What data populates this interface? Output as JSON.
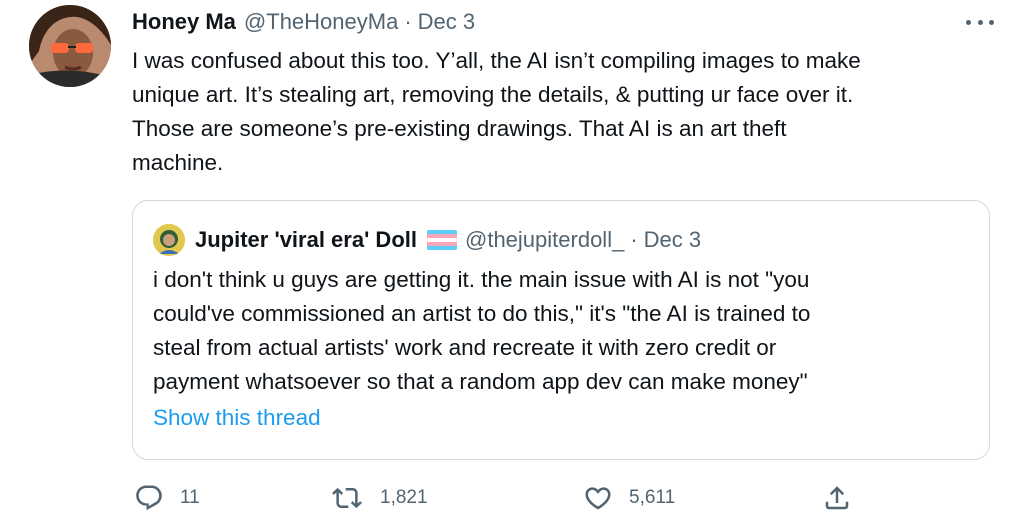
{
  "tweet": {
    "author_name": "Honey Ma",
    "author_handle": "@TheHoneyMa",
    "separator": "·",
    "date": "Dec 3",
    "lines": [
      "I was confused about this too. Y’all, the AI isn’t compiling images to make",
      "unique art. It’s stealing art, removing the details, & putting ur face over it.",
      "Those are someone’s pre-existing drawings. That AI is an art theft",
      "machine."
    ]
  },
  "quote": {
    "author_name": "Jupiter 'viral era' Doll",
    "author_handle": "@thejupiterdoll_",
    "separator": "·",
    "date": "Dec 3",
    "lines": [
      "i don't think u guys are getting it. the main issue with AI is not \"you",
      "could've commissioned an artist to do this,\" it's \"the AI is trained to",
      "steal from actual artists' work and recreate it with zero credit or",
      "payment whatsoever so that a random app dev can make money\""
    ],
    "show_thread": "Show this thread",
    "flag_colors": [
      "#5bcefa",
      "#f5a9b8",
      "#ffffff",
      "#f5a9b8",
      "#5bcefa"
    ]
  },
  "actions": {
    "replies": "11",
    "retweets": "1,821",
    "likes": "5,611"
  },
  "colors": {
    "text": "#0f1419",
    "secondary": "#536471",
    "link": "#1d9bf0",
    "border": "#cfd9de"
  },
  "icons": [
    "more-icon",
    "reply-icon",
    "retweet-icon",
    "like-icon",
    "share-icon",
    "trans-flag-icon"
  ]
}
